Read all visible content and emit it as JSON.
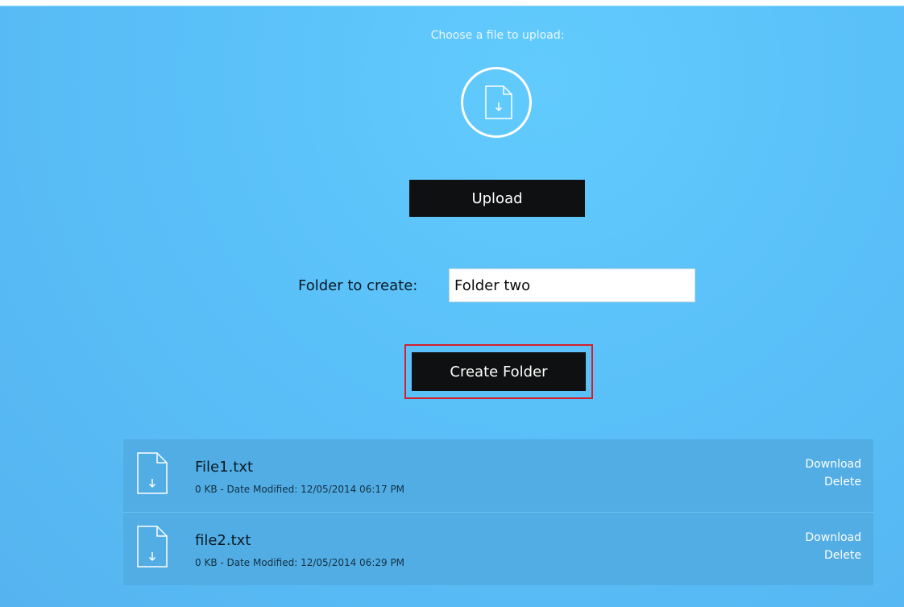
{
  "upload": {
    "heading": "Choose a file to upload:",
    "icon": "file-upload-icon",
    "button_label": "Upload"
  },
  "folder": {
    "label": "Folder to create:",
    "input_value": "Folder two",
    "create_button_label": "Create Folder"
  },
  "files": [
    {
      "name": "File1.txt",
      "meta": "0 KB - Date Modified: 12/05/2014 06:17 PM",
      "download": "Download",
      "delete": "Delete"
    },
    {
      "name": "file2.txt",
      "meta": "0 KB - Date Modified: 12/05/2014 06:29 PM",
      "download": "Download",
      "delete": "Delete"
    }
  ],
  "colors": {
    "background": "#5ac0f8",
    "button": "#0f1011",
    "highlight": "#d61e2b",
    "list_row": "#52ade5"
  }
}
